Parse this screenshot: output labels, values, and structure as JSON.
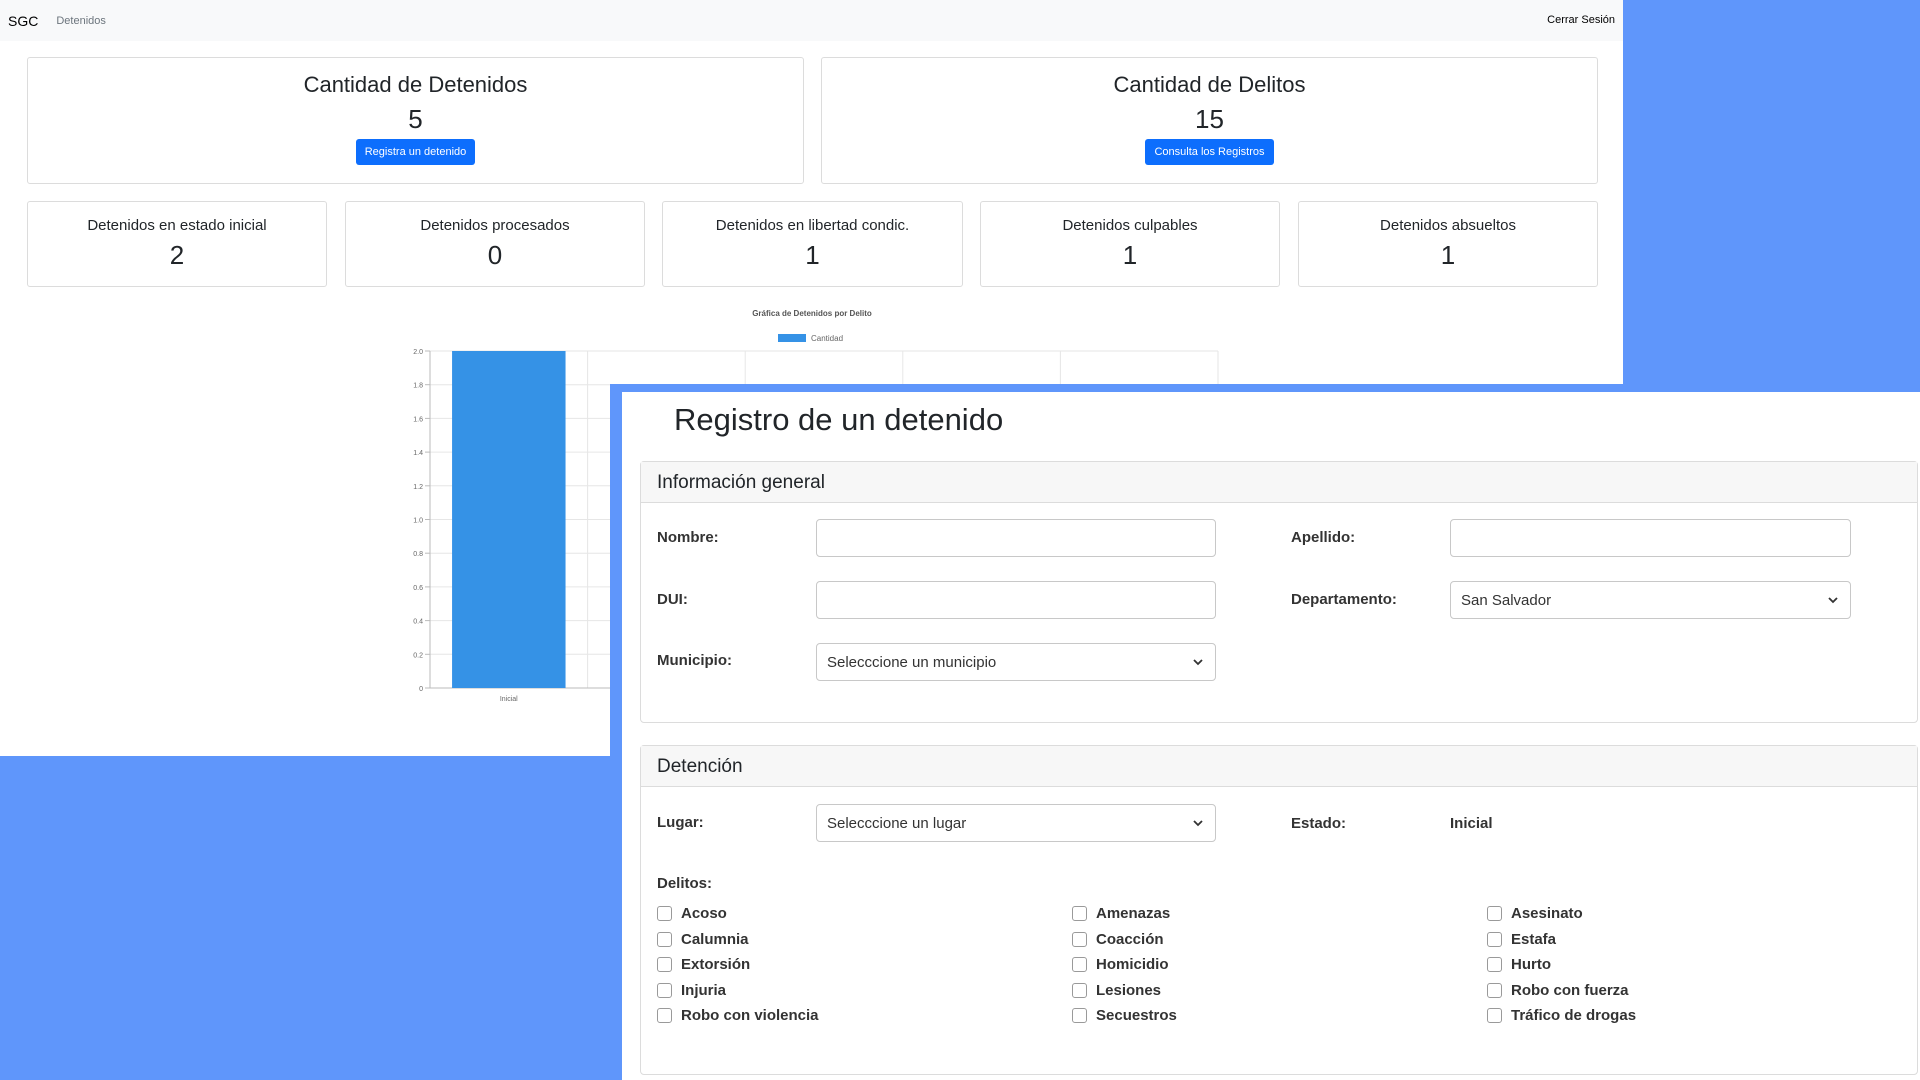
{
  "dashboard": {
    "nav": {
      "brand": "SGC",
      "link": "Detenidos",
      "logout": "Cerrar Sesión"
    },
    "cards": {
      "detenidos": {
        "title": "Cantidad de Detenidos",
        "value": "5",
        "button": "Registra un detenido"
      },
      "delitos": {
        "title": "Cantidad de Delitos",
        "value": "15",
        "button": "Consulta los Registros"
      }
    },
    "status_cards": [
      {
        "title": "Detenidos en estado inicial",
        "value": "2"
      },
      {
        "title": "Detenidos procesados",
        "value": "0"
      },
      {
        "title": "Detenidos en libertad condic.",
        "value": "1"
      },
      {
        "title": "Detenidos culpables",
        "value": "1"
      },
      {
        "title": "Detenidos absueltos",
        "value": "1"
      }
    ]
  },
  "chart_data": {
    "type": "bar",
    "title": "Gráfica de Detenidos por Delito",
    "categories": [
      "Inicial"
    ],
    "series": [
      {
        "name": "Cantidad",
        "values": [
          2
        ],
        "color": "#3592e6"
      }
    ],
    "ylim": [
      0,
      2.0
    ],
    "yticks": [
      "0",
      "0.2",
      "0.4",
      "0.6",
      "0.8",
      "1.0",
      "1.2",
      "1.4",
      "1.6",
      "1.8",
      "2.0"
    ],
    "grid": true,
    "legend": "top"
  },
  "form": {
    "title": "Registro de un detenido",
    "general": {
      "heading": "Información general",
      "nombre_label": "Nombre:",
      "nombre_value": "",
      "apellido_label": "Apellido:",
      "apellido_value": "",
      "dui_label": "DUI:",
      "dui_value": "",
      "departamento_label": "Departamento:",
      "departamento_value": "San Salvador",
      "municipio_label": "Municipio:",
      "municipio_value": "Selecccione un municipio"
    },
    "detencion": {
      "heading": "Detención",
      "lugar_label": "Lugar:",
      "lugar_value": "Selecccione un lugar",
      "estado_label": "Estado:",
      "estado_value": "Inicial",
      "delitos_label": "Delitos:",
      "delitos": [
        "Acoso",
        "Calumnia",
        "Extorsión",
        "Injuria",
        "Robo con violencia",
        "Amenazas",
        "Coacción",
        "Homicidio",
        "Lesiones",
        "Secuestros",
        "Asesinato",
        "Estafa",
        "Hurto",
        "Robo con fuerza",
        "Tráfico de drogas"
      ]
    }
  }
}
